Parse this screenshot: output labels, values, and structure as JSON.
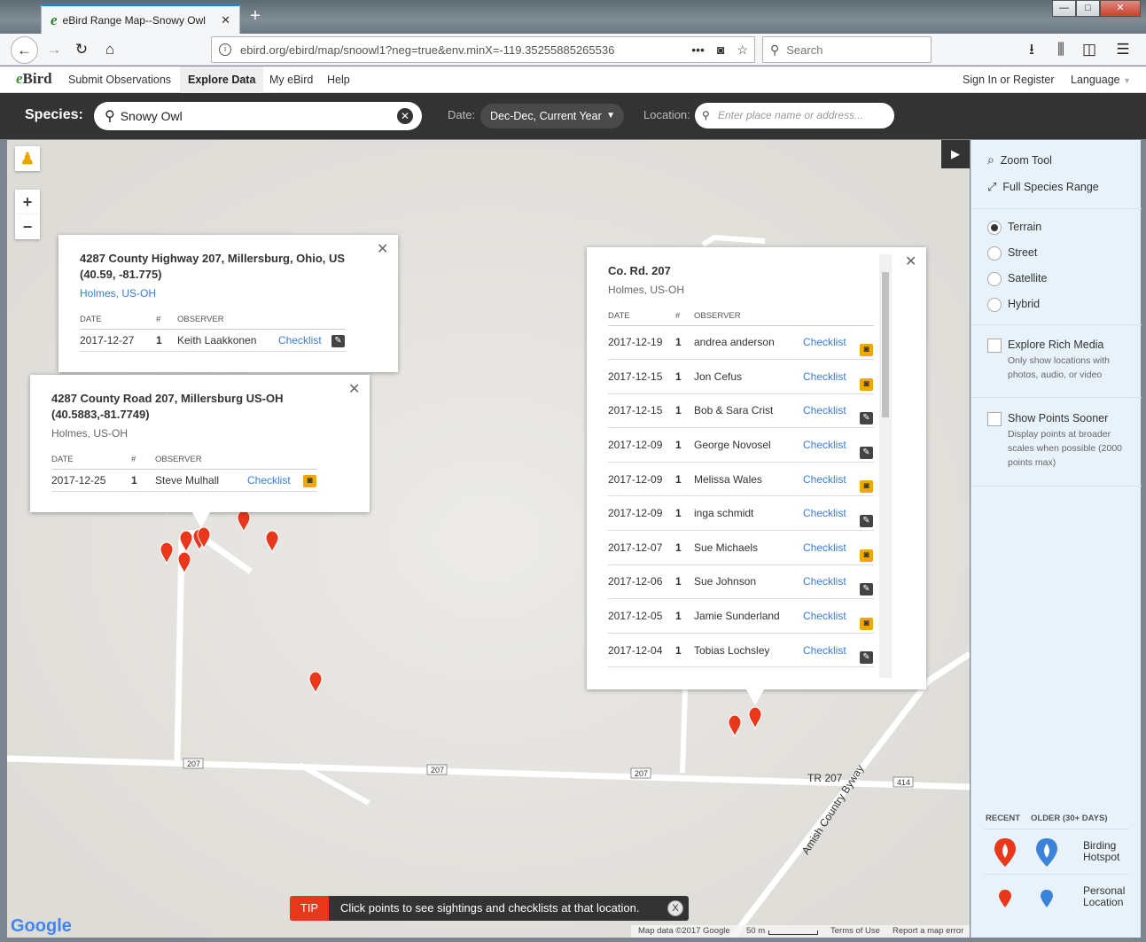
{
  "browser": {
    "tab_title": "eBird Range Map--Snowy Owl",
    "tab_icon": "e",
    "url": "ebird.org/ebird/map/snoowl1?neg=true&env.minX=-119.35255885265536",
    "search_placeholder": "Search"
  },
  "nav": {
    "logo_e": "e",
    "logo_rest": "Bird",
    "items": [
      "Submit Observations",
      "Explore Data",
      "My eBird",
      "Help"
    ],
    "sign_in": "Sign In or Register",
    "language": "Language"
  },
  "speciesbar": {
    "species_label": "Species:",
    "species_value": "Snowy Owl",
    "date_label": "Date:",
    "date_value": "Dec-Dec, Current Year",
    "location_label": "Location:",
    "location_placeholder": "Enter place name or address..."
  },
  "popup1": {
    "title": "4287 County Highway 207, Millersburg, Ohio, US (40.59, -81.775)",
    "region": "Holmes, US-OH",
    "headers": [
      "DATE",
      "#",
      "OBSERVER"
    ],
    "rows": [
      {
        "date": "2017-12-27",
        "count": "1",
        "observer": "Keith Laakkonen",
        "link": "Checklist",
        "icon": "pencil"
      }
    ]
  },
  "popup2": {
    "title": "4287 County Road 207, Millersburg US-OH (40.5883,-81.7749)",
    "region": "Holmes, US-OH",
    "headers": [
      "DATE",
      "#",
      "OBSERVER"
    ],
    "rows": [
      {
        "date": "2017-12-25",
        "count": "1",
        "observer": "Steve Mulhall",
        "link": "Checklist",
        "icon": "camera"
      }
    ]
  },
  "popup3": {
    "title": "Co. Rd. 207",
    "region": "Holmes, US-OH",
    "headers": [
      "DATE",
      "#",
      "OBSERVER"
    ],
    "rows": [
      {
        "date": "2017-12-19",
        "count": "1",
        "observer": "andrea anderson",
        "link": "Checklist",
        "icon": "camera"
      },
      {
        "date": "2017-12-15",
        "count": "1",
        "observer": "Jon Cefus",
        "link": "Checklist",
        "icon": "camera"
      },
      {
        "date": "2017-12-15",
        "count": "1",
        "observer": "Bob & Sara Crist",
        "link": "Checklist",
        "icon": "pencil"
      },
      {
        "date": "2017-12-09",
        "count": "1",
        "observer": "George Novosel",
        "link": "Checklist",
        "icon": "pencil"
      },
      {
        "date": "2017-12-09",
        "count": "1",
        "observer": "Melissa Wales",
        "link": "Checklist",
        "icon": "camera"
      },
      {
        "date": "2017-12-09",
        "count": "1",
        "observer": "inga schmidt",
        "link": "Checklist",
        "icon": "pencil"
      },
      {
        "date": "2017-12-07",
        "count": "1",
        "observer": "Sue Michaels",
        "link": "Checklist",
        "icon": "camera"
      },
      {
        "date": "2017-12-06",
        "count": "1",
        "observer": "Sue Johnson",
        "link": "Checklist",
        "icon": "pencil"
      },
      {
        "date": "2017-12-05",
        "count": "1",
        "observer": "Jamie Sunderland",
        "link": "Checklist",
        "icon": "camera"
      },
      {
        "date": "2017-12-04",
        "count": "1",
        "observer": "Tobias Lochsley",
        "link": "Checklist",
        "icon": "pencil"
      }
    ]
  },
  "sidebar": {
    "tools": [
      "Zoom Tool",
      "Full Species Range"
    ],
    "layers": [
      "Terrain",
      "Street",
      "Satellite",
      "Hybrid"
    ],
    "selected_layer": "Terrain",
    "rich_media_label": "Explore Rich Media",
    "rich_media_desc": "Only show locations with photos, audio, or video",
    "points_sooner_label": "Show Points Sooner",
    "points_sooner_desc": "Display points at broader scales when possible (2000 points max)",
    "legend_recent": "RECENT",
    "legend_older": "OLDER (30+ DAYS)",
    "legend_hotspot": "Birding Hotspot",
    "legend_personal": "Personal Location",
    "recent_color": "#e8371a",
    "older_color": "#3b83d9"
  },
  "map": {
    "road_labels": [
      "207",
      "207",
      "207",
      "TR 207",
      "414",
      "Amish Country Byway"
    ],
    "google_logo": "Google",
    "attribution": {
      "map_data": "Map data ©2017 Google",
      "scale": "50 m",
      "terms": "Terms of Use",
      "report": "Report a map error"
    }
  },
  "tip": {
    "label": "TIP",
    "message": "Click points to see sightings and checklists at that location.",
    "close": "X"
  }
}
